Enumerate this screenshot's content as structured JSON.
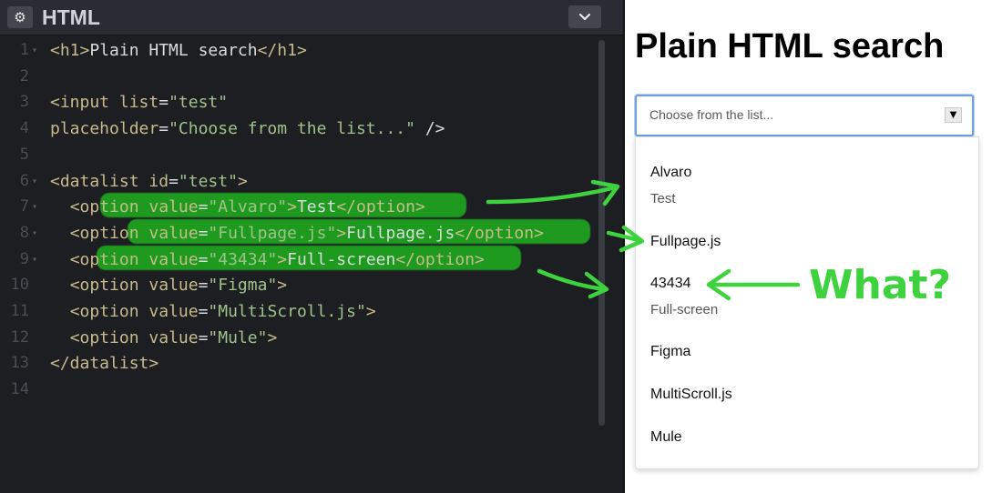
{
  "editor": {
    "title": "HTML",
    "lines": [
      {
        "n": "1",
        "fold": true,
        "segs": [
          [
            "t",
            "<h1>"
          ],
          [
            "p",
            "Plain HTML search"
          ],
          [
            "t",
            "</h1>"
          ]
        ]
      },
      {
        "n": "2",
        "fold": false,
        "segs": []
      },
      {
        "n": "3",
        "fold": false,
        "segs": [
          [
            "t",
            "<input "
          ],
          [
            "a",
            "list"
          ],
          [
            "p",
            "="
          ],
          [
            "s",
            "\"test\""
          ]
        ]
      },
      {
        "n": "4",
        "fold": false,
        "segs": [
          [
            "a",
            "placeholder"
          ],
          [
            "p",
            "="
          ],
          [
            "s",
            "\"Choose from the list...\""
          ],
          [
            "p",
            " />"
          ]
        ]
      },
      {
        "n": "5",
        "fold": false,
        "segs": []
      },
      {
        "n": "6",
        "fold": true,
        "segs": [
          [
            "t",
            "<datalist "
          ],
          [
            "a",
            "id"
          ],
          [
            "p",
            "="
          ],
          [
            "s",
            "\"test\""
          ],
          [
            "t",
            ">"
          ]
        ]
      },
      {
        "n": "7",
        "fold": true,
        "segs": [
          [
            "p",
            "  "
          ],
          [
            "t",
            "<option "
          ],
          [
            "a",
            "value"
          ],
          [
            "p",
            "="
          ],
          [
            "s",
            "\"Alvaro\""
          ],
          [
            "t",
            ">"
          ],
          [
            "p",
            "Test"
          ],
          [
            "t",
            "</option>"
          ]
        ]
      },
      {
        "n": "8",
        "fold": true,
        "segs": [
          [
            "p",
            "  "
          ],
          [
            "t",
            "<option "
          ],
          [
            "a",
            "value"
          ],
          [
            "p",
            "="
          ],
          [
            "s",
            "\"Fullpage.js\""
          ],
          [
            "t",
            ">"
          ],
          [
            "p",
            "Fullpage.js"
          ],
          [
            "t",
            "</option>"
          ]
        ]
      },
      {
        "n": "9",
        "fold": true,
        "segs": [
          [
            "p",
            "  "
          ],
          [
            "t",
            "<option "
          ],
          [
            "a",
            "value"
          ],
          [
            "p",
            "="
          ],
          [
            "s",
            "\"43434\""
          ],
          [
            "t",
            ">"
          ],
          [
            "p",
            "Full-screen"
          ],
          [
            "t",
            "</option>"
          ]
        ]
      },
      {
        "n": "10",
        "fold": false,
        "segs": [
          [
            "p",
            "  "
          ],
          [
            "t",
            "<option "
          ],
          [
            "a",
            "value"
          ],
          [
            "p",
            "="
          ],
          [
            "s",
            "\"Figma\""
          ],
          [
            "t",
            ">"
          ]
        ]
      },
      {
        "n": "11",
        "fold": false,
        "segs": [
          [
            "p",
            "  "
          ],
          [
            "t",
            "<option "
          ],
          [
            "a",
            "value"
          ],
          [
            "p",
            "="
          ],
          [
            "s",
            "\"MultiScroll.js\""
          ],
          [
            "t",
            ">"
          ]
        ]
      },
      {
        "n": "12",
        "fold": false,
        "segs": [
          [
            "p",
            "  "
          ],
          [
            "t",
            "<option "
          ],
          [
            "a",
            "value"
          ],
          [
            "p",
            "="
          ],
          [
            "s",
            "\"Mule\""
          ],
          [
            "t",
            ">"
          ]
        ]
      },
      {
        "n": "13",
        "fold": false,
        "segs": [
          [
            "t",
            "</datalist>"
          ]
        ]
      },
      {
        "n": "14",
        "fold": false,
        "segs": []
      }
    ],
    "highlighted_lines": [
      "7",
      "8",
      "9"
    ],
    "fold_glyph": "▾"
  },
  "preview": {
    "heading": "Plain HTML search",
    "input_placeholder": "Choose from the list...",
    "options": [
      {
        "value": "Alvaro",
        "label": "Test"
      },
      {
        "value": "Fullpage.js",
        "label": ""
      },
      {
        "value": "43434",
        "label": "Full-screen"
      },
      {
        "value": "Figma",
        "label": ""
      },
      {
        "value": "MultiScroll.js",
        "label": ""
      },
      {
        "value": "Mule",
        "label": ""
      }
    ]
  },
  "annotation": {
    "text": "What?",
    "color": "#3fd23f"
  },
  "colors": {
    "editor_bg": "#1d1e22",
    "tag": "#c7bb8c",
    "string": "#9ec28a",
    "highlight": "#1fcc1f",
    "focus_ring": "#6e9ee8"
  }
}
